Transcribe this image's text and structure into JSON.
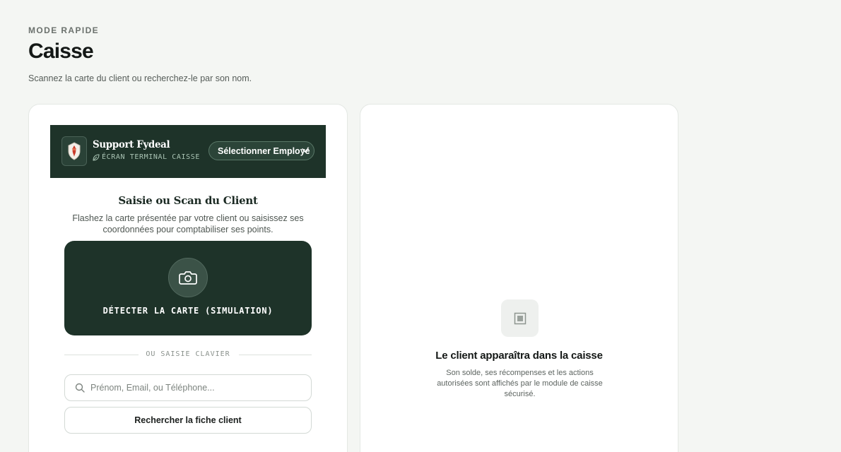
{
  "header": {
    "eyebrow": "MODE RAPIDE",
    "title": "Caisse",
    "subtitle": "Scannez la carte du client ou recherchez-le par son nom."
  },
  "terminal": {
    "brand_name": "Support Fydeal",
    "brand_sub": "ÉCRAN TERMINAL CAISSE",
    "brand_sub_icon": "leaf-icon",
    "employee_select": "Sélectionner Employé",
    "bg_color": "#1e3329"
  },
  "scan": {
    "title": "Saisie ou Scan du Client",
    "description": "Flashez la carte présentée par votre client ou saisissez ses coordonnées pour comptabiliser ses points.",
    "button_label": "DÉTECTER LA CARTE (SIMULATION)",
    "icon": "camera-icon"
  },
  "divider": {
    "label": "OU SAISIE CLAVIER"
  },
  "search": {
    "placeholder": "Prénom, Email, ou Téléphone...",
    "value": "",
    "button_label": "Rechercher la fiche client",
    "icon": "search-icon"
  },
  "empty_state": {
    "icon": "terminal-icon",
    "title": "Le client apparaîtra dans la caisse",
    "description": "Son solde, ses récompenses et les actions autorisées sont affichés par le module de caisse sécurisé."
  }
}
